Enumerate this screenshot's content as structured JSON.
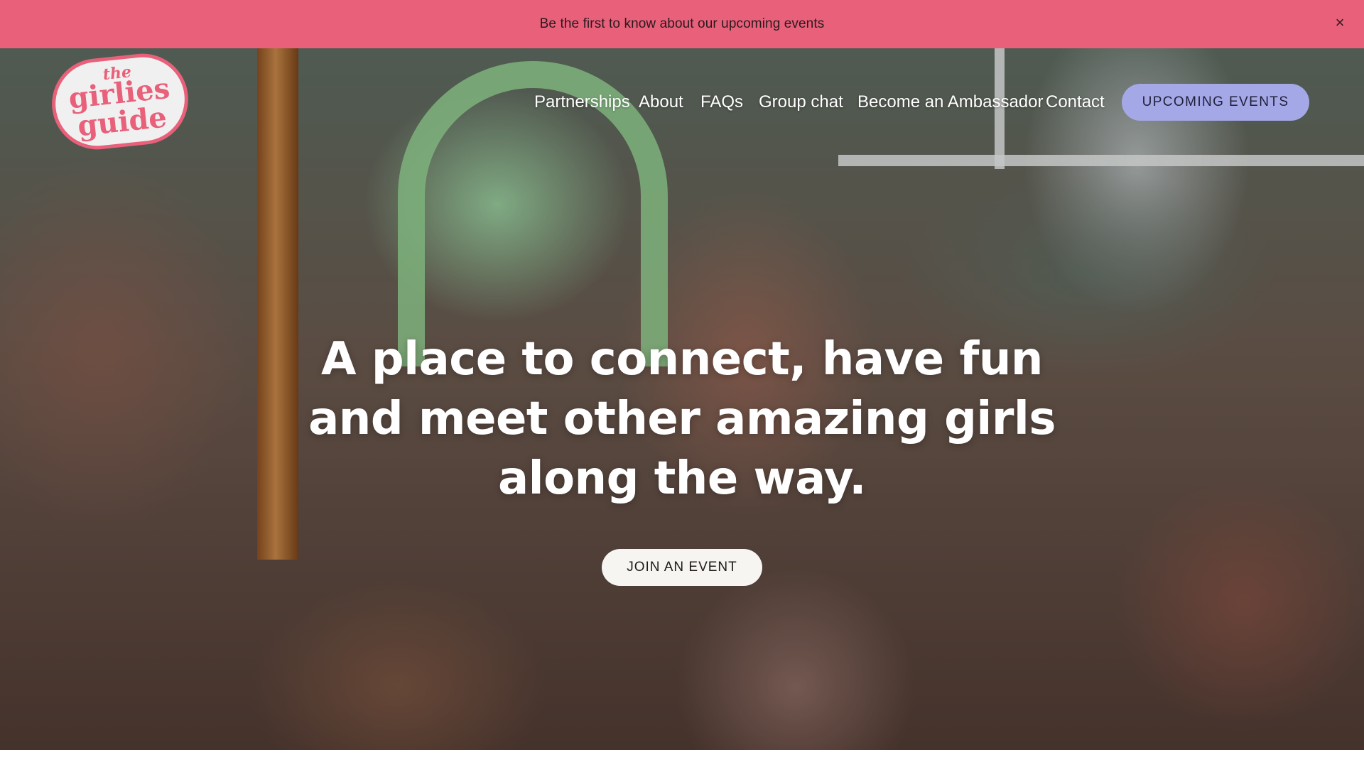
{
  "announcement": {
    "text": "Be the first to know about our upcoming events",
    "close_label": "×"
  },
  "logo": {
    "line1": "the",
    "line2": "girlies",
    "line3": "guide",
    "brand_color": "#e8607a"
  },
  "nav": {
    "items": [
      {
        "label": "Partnerships"
      },
      {
        "label": "About"
      },
      {
        "label": "FAQs"
      },
      {
        "label": "Group chat"
      },
      {
        "label": "Become an Ambassador"
      },
      {
        "label": "Contact"
      }
    ],
    "cta_label": "UPCOMING EVENTS",
    "cta_color": "#a4a8e6"
  },
  "hero": {
    "headline_line1": "A place to connect, have fun",
    "headline_line2": "and meet other amazing girls",
    "headline_line3": "along the way.",
    "button_label": "JOIN AN EVENT"
  },
  "colors": {
    "announcement_bg": "#e8607a",
    "text_on_hero": "#ffffff"
  }
}
